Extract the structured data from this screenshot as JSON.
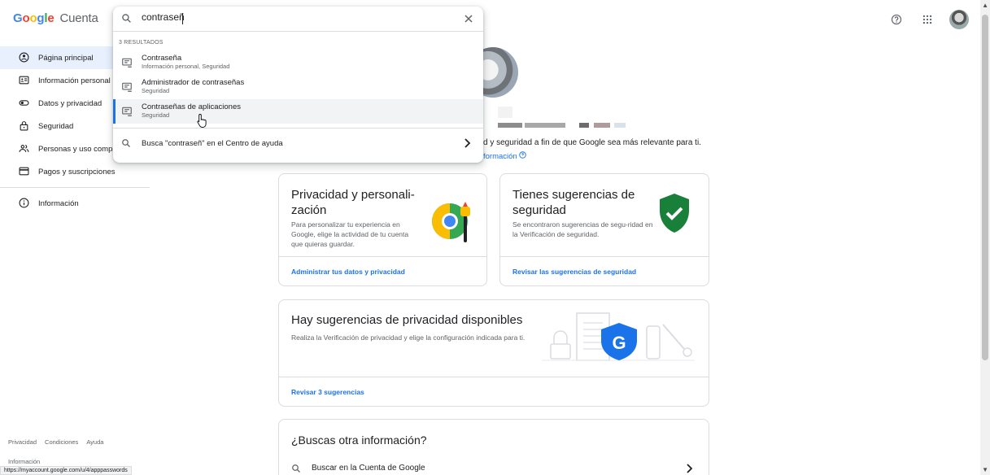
{
  "header": {
    "brand_letters": [
      "G",
      "o",
      "o",
      "g",
      "l",
      "e"
    ],
    "brand_colors": [
      "#4285f4",
      "#ea4335",
      "#fbbc05",
      "#4285f4",
      "#34a853",
      "#ea4335"
    ],
    "product": "Cuenta",
    "icons": [
      "help-icon",
      "apps-grid-icon",
      "account-avatar"
    ]
  },
  "search": {
    "value": "contraseñ",
    "results_count": "3 RESULTADOS",
    "results": [
      {
        "title": "Contraseña",
        "subtitle": "Información personal, Seguridad"
      },
      {
        "title": "Administrador de contraseñas",
        "subtitle": "Seguridad"
      },
      {
        "title": "Contraseñas de aplicaciones",
        "subtitle": "Seguridad"
      }
    ],
    "help": "Busca \"contraseñ\" en el Centro de ayuda"
  },
  "sidebar": {
    "items": [
      {
        "label": "Página principal",
        "icon": "home-icon"
      },
      {
        "label": "Información personal",
        "icon": "id-card-icon"
      },
      {
        "label": "Datos y privacidad",
        "icon": "toggle-icon"
      },
      {
        "label": "Seguridad",
        "icon": "lock-icon"
      },
      {
        "label": "Personas y uso compartido",
        "icon": "people-icon"
      },
      {
        "label": "Pagos y suscripciones",
        "icon": "credit-card-icon"
      }
    ],
    "info": {
      "label": "Información",
      "icon": "info-icon"
    }
  },
  "footer": {
    "links": [
      "Privacidad",
      "Condiciones",
      "Ayuda"
    ],
    "info": "Información",
    "status_url": "https://myaccount.google.com/u/4/apppasswords"
  },
  "main": {
    "intro": "d y seguridad a fin de que Google sea más relevante para ti.",
    "intro_link": "formación",
    "cards": {
      "privacy": {
        "title": "Privacidad y personali-\nzación",
        "desc": "Para personalizar tu experiencia en Google, elige la actividad de tu cuenta que quieras guardar.",
        "link": "Administrar tus datos y privacidad"
      },
      "security": {
        "title": "Tienes sugerencias de seguridad",
        "desc": "Se encontraron sugerencias de segu-ridad en la Verificación de seguridad.",
        "link": "Revisar las sugerencias de seguridad"
      },
      "privacy_suggestions": {
        "title": "Hay sugerencias de privacidad disponibles",
        "desc": "Realiza la Verificación de privacidad y elige la configuración indicada para ti.",
        "link": "Revisar 3 sugerencias"
      },
      "other": {
        "title": "¿Buscas otra información?",
        "search_link": "Buscar en la Cuenta de Google"
      }
    }
  },
  "colors": {
    "accent": "#1a73e8",
    "active_nav": "#e8f0fe",
    "shield_green": "#188038",
    "shield_blue": "#1a73e8"
  }
}
